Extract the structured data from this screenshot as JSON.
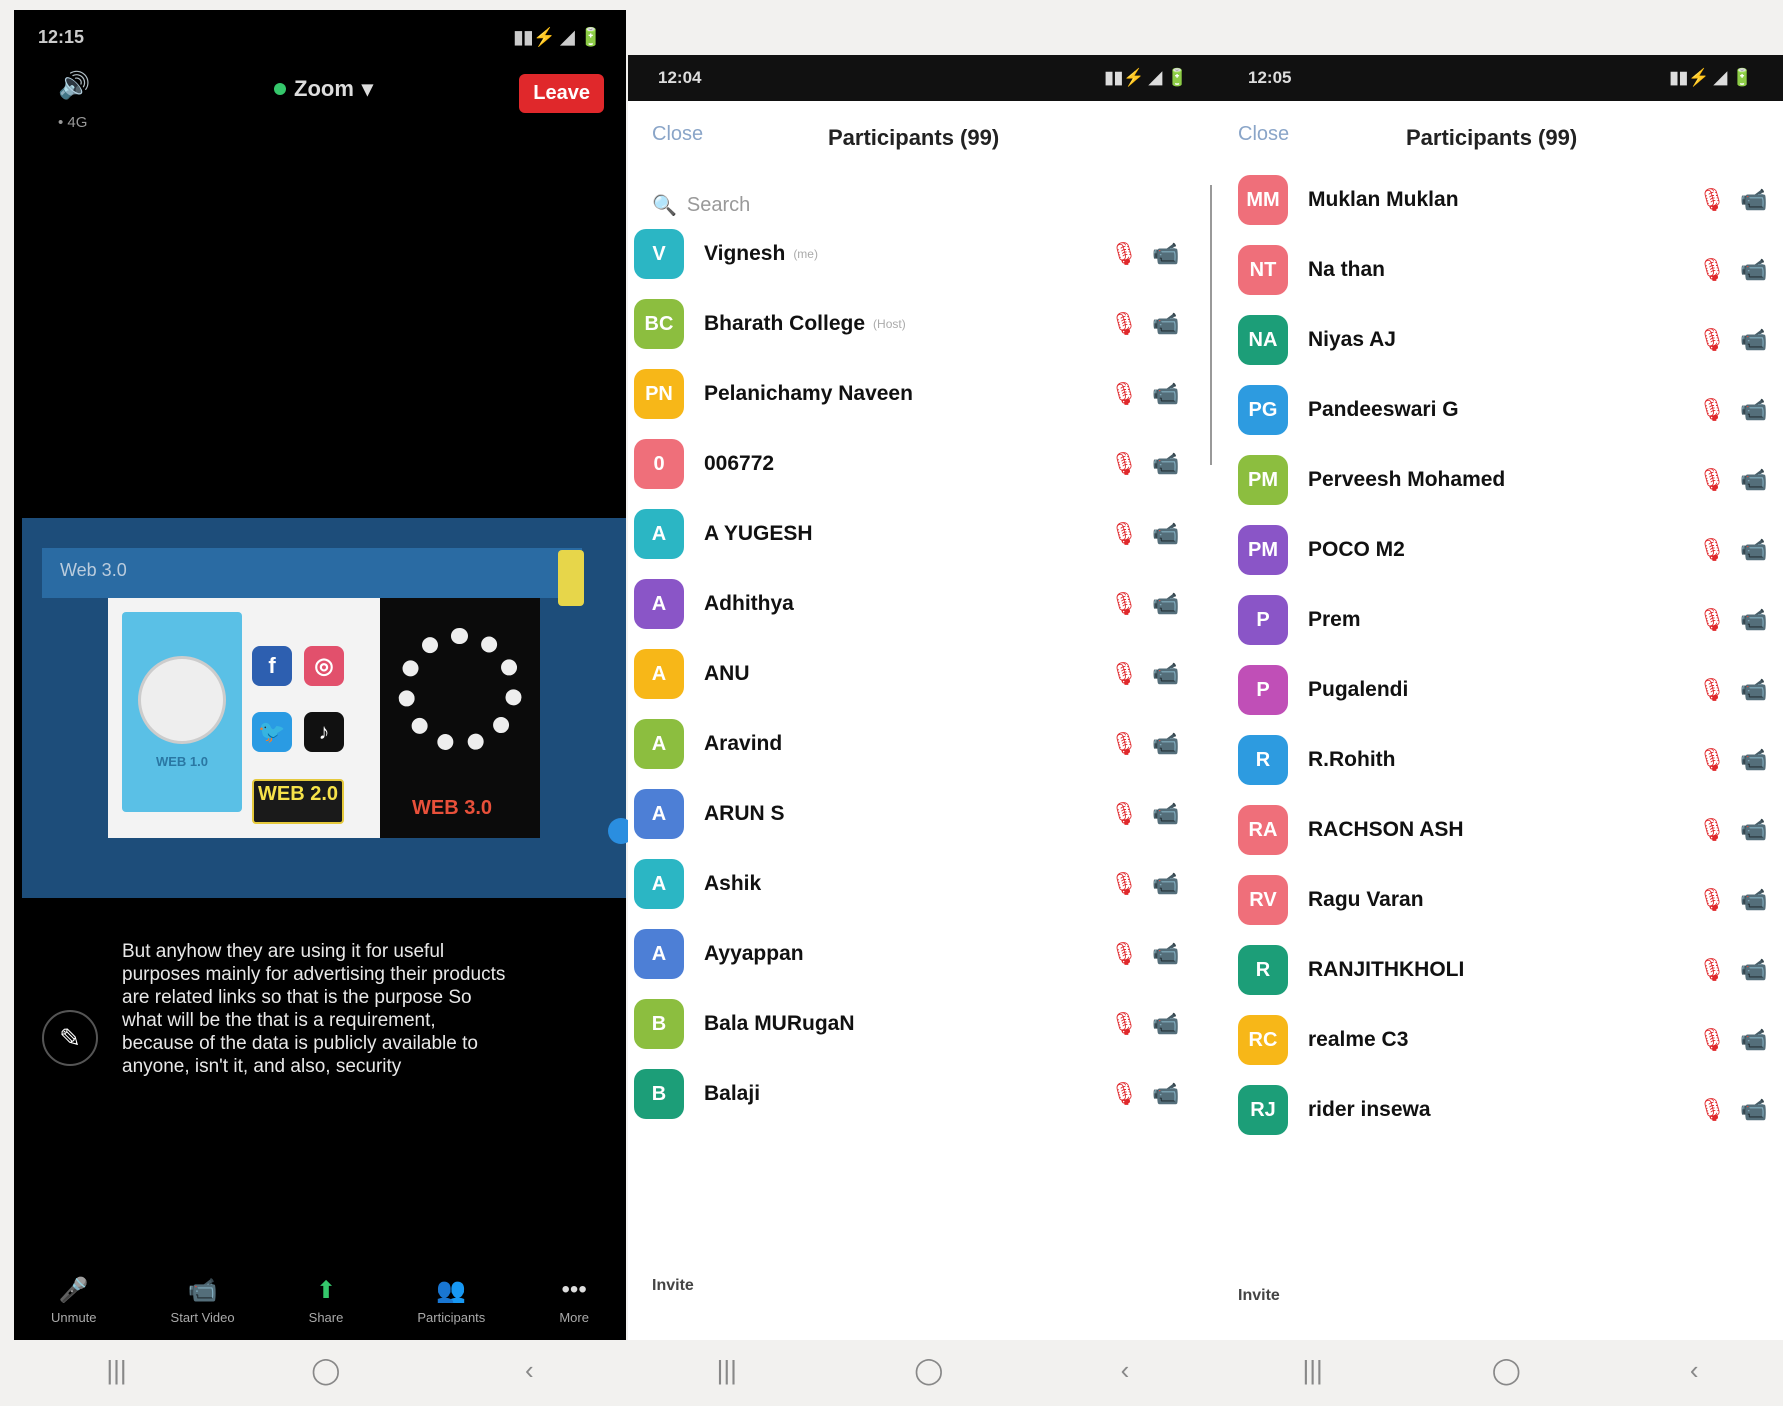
{
  "meeting": {
    "status_time": "12:15",
    "status_icons": "▮▮⚡ ◢ 🔋",
    "zoom_title": "Zoom",
    "leave_label": "Leave",
    "sub_text": "• 4G",
    "slide_header": "Web 3.0",
    "web1_label": "WEB 1.0",
    "web2_label": "WEB 2.0",
    "web3_label": "WEB 3.0",
    "caption": "But anyhow they are using it for useful purposes mainly for advertising their products are related links so that is the purpose So what will be the that is a requirement, because of the data is publicly available to anyone, isn't it, and also, security",
    "toolbar": [
      {
        "icon": "🎤",
        "label": "Unmute",
        "name": "unmute-button"
      },
      {
        "icon": "📹",
        "label": "Start Video",
        "name": "start-video-button"
      },
      {
        "icon": "⬆",
        "label": "Share",
        "name": "share-button"
      },
      {
        "icon": "👥",
        "label": "Participants",
        "name": "participants-button"
      },
      {
        "icon": "•••",
        "label": "More",
        "name": "more-button"
      }
    ]
  },
  "panel_a": {
    "status_time": "12:04",
    "close_label": "Close",
    "title": "Participants (99)",
    "search_placeholder": "Search",
    "invite_label": "Invite",
    "participants": [
      {
        "initials": "V",
        "name": "Vignesh",
        "tag": "(me)",
        "color": "#2bb6c4"
      },
      {
        "initials": "BC",
        "name": "Bharath College",
        "tag": "(Host)",
        "color": "#8cbe3f"
      },
      {
        "initials": "PN",
        "name": "Pelanichamy Naveen",
        "tag": "",
        "color": "#f7b718"
      },
      {
        "initials": "0",
        "name": "006772",
        "tag": "",
        "color": "#ef6f7a"
      },
      {
        "initials": "A",
        "name": "A YUGESH",
        "tag": "",
        "color": "#2bb6c4"
      },
      {
        "initials": "A",
        "name": "Adhithya",
        "tag": "",
        "color": "#8a55c7"
      },
      {
        "initials": "A",
        "name": "ANU",
        "tag": "",
        "color": "#f7b718"
      },
      {
        "initials": "A",
        "name": "Aravind",
        "tag": "",
        "color": "#8cbe3f"
      },
      {
        "initials": "A",
        "name": "ARUN S",
        "tag": "",
        "color": "#4d7fd6"
      },
      {
        "initials": "A",
        "name": "Ashik",
        "tag": "",
        "color": "#2bb6c4"
      },
      {
        "initials": "A",
        "name": "Ayyappan",
        "tag": "",
        "color": "#4d7fd6"
      },
      {
        "initials": "B",
        "name": "Bala MURugaN",
        "tag": "",
        "color": "#8cbe3f"
      },
      {
        "initials": "B",
        "name": "Balaji",
        "tag": "",
        "color": "#1c9e78"
      }
    ]
  },
  "panel_b": {
    "status_time": "12:05",
    "close_label": "Close",
    "title": "Participants (99)",
    "invite_label": "Invite",
    "participants": [
      {
        "initials": "MM",
        "name": "Muklan Muklan",
        "color": "#ef6f7a"
      },
      {
        "initials": "NT",
        "name": "Na than",
        "color": "#ef6f7a"
      },
      {
        "initials": "NA",
        "name": "Niyas AJ",
        "color": "#1c9e78"
      },
      {
        "initials": "PG",
        "name": "Pandeeswari G",
        "color": "#2d9be0"
      },
      {
        "initials": "PM",
        "name": "Perveesh Mohamed",
        "color": "#8cbe3f"
      },
      {
        "initials": "PM",
        "name": "POCO M2",
        "color": "#8a55c7"
      },
      {
        "initials": "P",
        "name": "Prem",
        "color": "#8a55c7"
      },
      {
        "initials": "P",
        "name": "Pugalendi",
        "color": "#c04fb7"
      },
      {
        "initials": "R",
        "name": "R.Rohith",
        "color": "#2d9be0"
      },
      {
        "initials": "RA",
        "name": "RACHSON ASH",
        "color": "#ef6f7a"
      },
      {
        "initials": "RV",
        "name": "Ragu Varan",
        "color": "#ef6f7a"
      },
      {
        "initials": "R",
        "name": "RANJITHKHOLI",
        "color": "#1c9e78"
      },
      {
        "initials": "RC",
        "name": "realme C3",
        "color": "#f7b718"
      },
      {
        "initials": "RJ",
        "name": "rider insewa",
        "color": "#1c9e78"
      }
    ]
  },
  "nav": {
    "recent": "|||",
    "home": "◯",
    "back": "‹"
  }
}
